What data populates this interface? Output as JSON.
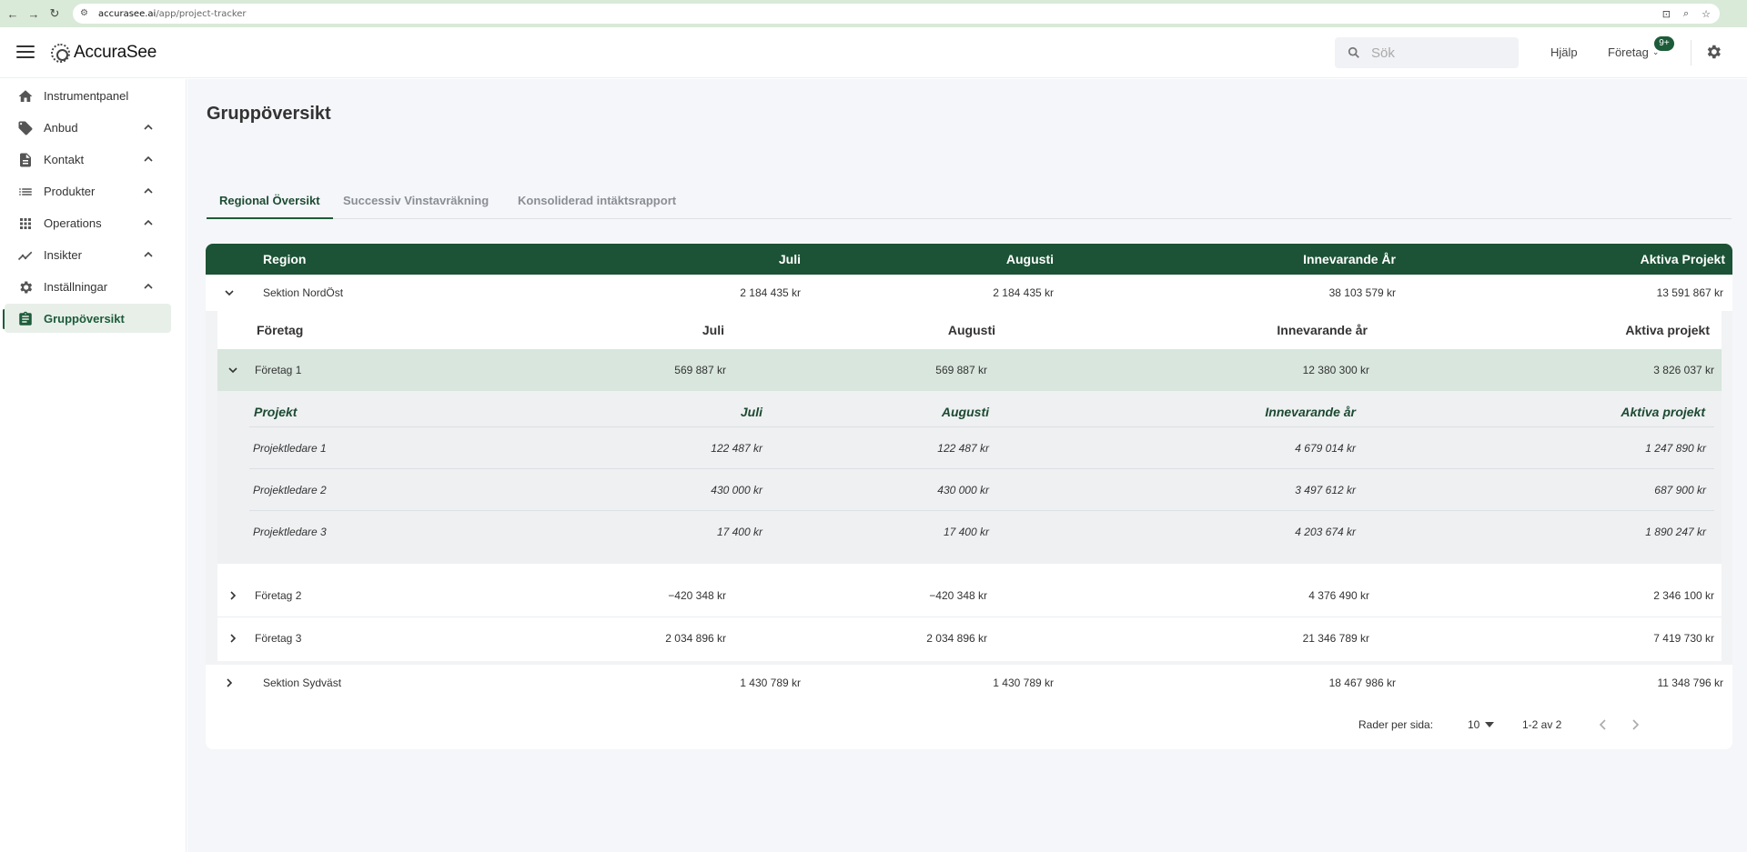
{
  "browser": {
    "url_host": "accurasee.ai",
    "url_path": "/app/project-tracker"
  },
  "header": {
    "brand": "AccuraSee",
    "search_placeholder": "Sök",
    "help": "Hjälp",
    "company_menu": "Företag",
    "notification_badge": "9+"
  },
  "sidebar": {
    "items": [
      {
        "label": "Instrumentpanel",
        "icon": "home-icon"
      },
      {
        "label": "Anbud",
        "icon": "tag-icon"
      },
      {
        "label": "Kontakt",
        "icon": "document-icon"
      },
      {
        "label": "Produkter",
        "icon": "list-icon"
      },
      {
        "label": "Operations",
        "icon": "grid-icon"
      },
      {
        "label": "Insikter",
        "icon": "trend-icon"
      },
      {
        "label": "Inställningar",
        "icon": "gear-icon"
      },
      {
        "label": "Gruppöversikt",
        "icon": "clipboard-icon",
        "active": true
      }
    ]
  },
  "main": {
    "title": "Gruppöversikt",
    "tabs": [
      "Regional Översikt",
      "Successiv Vinstavräkning",
      "Konsoliderad intäktsrapport"
    ],
    "table": {
      "columns": [
        "Region",
        "Juli",
        "Augusti",
        "Innevarande År",
        "Aktiva Projekt"
      ],
      "regions": [
        {
          "name": "Sektion NordÖst",
          "juli": "2 184 435 kr",
          "augusti": "2 184 435 kr",
          "ar": "38 103 579 kr",
          "aktiva": "13 591 867 kr"
        },
        {
          "name": "Sektion Sydväst",
          "juli": "1 430 789 kr",
          "augusti": "1 430 789 kr",
          "ar": "18 467 986 kr",
          "aktiva": "11 348 796 kr"
        }
      ],
      "company_columns": [
        "Företag",
        "Juli",
        "Augusti",
        "Innevarande år",
        "Aktiva projekt"
      ],
      "companies": [
        {
          "name": "Företag 1",
          "juli": "569 887 kr",
          "augusti": "569 887 kr",
          "ar": "12 380 300 kr",
          "aktiva": "3 826 037 kr"
        },
        {
          "name": "Företag 2",
          "juli": "−420 348 kr",
          "augusti": "−420 348 kr",
          "ar": "4 376 490 kr",
          "aktiva": "2 346 100 kr"
        },
        {
          "name": "Företag 3",
          "juli": "2 034 896 kr",
          "augusti": "2 034 896 kr",
          "ar": "21 346 789 kr",
          "aktiva": "7 419 730 kr"
        }
      ],
      "project_columns": [
        "Projekt",
        "Juli",
        "Augusti",
        "Innevarande år",
        "Aktiva projekt"
      ],
      "projects": [
        {
          "name": "Projektledare 1",
          "juli": "122 487 kr",
          "augusti": "122 487 kr",
          "ar": "4 679 014 kr",
          "aktiva": "1 247 890 kr"
        },
        {
          "name": "Projektledare 2",
          "juli": "430 000 kr",
          "augusti": "430 000 kr",
          "ar": "3 497 612 kr",
          "aktiva": "687 900 kr"
        },
        {
          "name": "Projektledare 3",
          "juli": "17 400 kr",
          "augusti": "17 400 kr",
          "ar": "4 203 674 kr",
          "aktiva": "1 890 247 kr"
        }
      ]
    },
    "pagination": {
      "rows_label": "Rader per sida:",
      "rows_value": "10",
      "range": "1-2 av 2"
    }
  },
  "colors": {
    "accent": "#1d5c3a",
    "header_bg": "#1c5235",
    "highlight_row": "#d8e6dd"
  }
}
